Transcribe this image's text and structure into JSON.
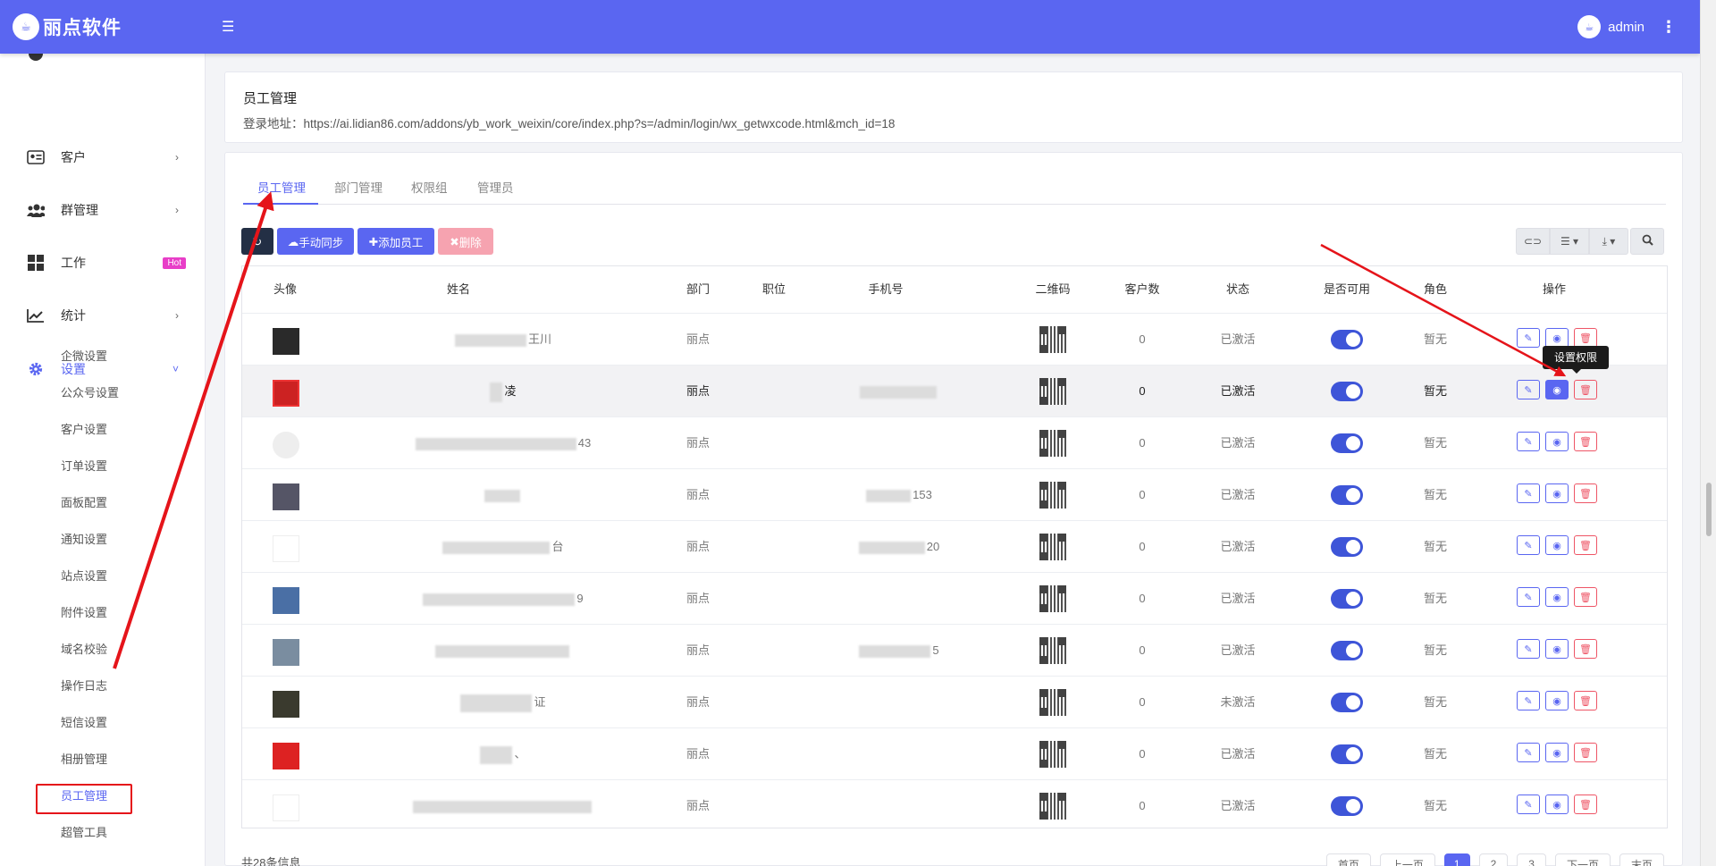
{
  "app": {
    "brand": "丽点软件",
    "user": "admin"
  },
  "sidebar": {
    "items": [
      {
        "label": "客户",
        "icon": "id-card-icon"
      },
      {
        "label": "群管理",
        "icon": "users-icon"
      },
      {
        "label": "工作",
        "icon": "grid-icon",
        "badge": "Hot"
      },
      {
        "label": "统计",
        "icon": "chart-line-icon"
      },
      {
        "label": "设置",
        "icon": "gear-icon"
      }
    ],
    "sub_items": [
      "企微设置",
      "公众号设置",
      "客户设置",
      "订单设置",
      "面板配置",
      "通知设置",
      "站点设置",
      "附件设置",
      "域名校验",
      "操作日志",
      "短信设置",
      "相册管理",
      "员工管理",
      "超管工具"
    ]
  },
  "header_card": {
    "title": "员工管理",
    "login_url": "登录地址：https://ai.lidian86.com/addons/yb_work_weixin/core/index.php?s=/admin/login/wx_getwxcode.html&mch_id=18"
  },
  "tabs": [
    "员工管理",
    "部门管理",
    "权限组",
    "管理员"
  ],
  "toolbar": {
    "sync": "手动同步",
    "add": "添加员工",
    "delete": "删除"
  },
  "table": {
    "columns": [
      "头像",
      "姓名",
      "部门",
      "职位",
      "手机号",
      "二维码",
      "客户数",
      "状态",
      "是否可用",
      "角色",
      "操作"
    ],
    "rows": [
      {
        "name": "王川",
        "dept": "丽点",
        "phone": "",
        "customers": "0",
        "status": "已激活",
        "role": "暂无"
      },
      {
        "name": "凌",
        "dept": "丽点",
        "phone": "",
        "customers": "0",
        "status": "已激活",
        "role": "暂无"
      },
      {
        "name": "43",
        "dept": "丽点",
        "phone": "",
        "customers": "0",
        "status": "已激活",
        "role": "暂无"
      },
      {
        "name": "",
        "dept": "丽点",
        "phone": "153",
        "customers": "0",
        "status": "已激活",
        "role": "暂无"
      },
      {
        "name": "台",
        "dept": "丽点",
        "phone": "20",
        "customers": "0",
        "status": "已激活",
        "role": "暂无"
      },
      {
        "name": "9",
        "dept": "丽点",
        "phone": "",
        "customers": "0",
        "status": "已激活",
        "role": "暂无"
      },
      {
        "name": "",
        "dept": "丽点",
        "phone": "5",
        "customers": "0",
        "status": "已激活",
        "role": "暂无"
      },
      {
        "name": "证",
        "dept": "丽点",
        "phone": "",
        "customers": "0",
        "status": "未激活",
        "role": "暂无"
      },
      {
        "name": "、",
        "dept": "丽点",
        "phone": "",
        "customers": "0",
        "status": "已激活",
        "role": "暂无"
      },
      {
        "name": "",
        "dept": "丽点",
        "phone": "",
        "customers": "0",
        "status": "已激活",
        "role": "暂无"
      }
    ]
  },
  "tooltip": "设置权限",
  "footer": {
    "total": "共28条信息",
    "pages": [
      "首页",
      "上一页",
      "1",
      "2",
      "3",
      "下一页",
      "末页"
    ]
  },
  "colors": {
    "primary": "#5a66f1",
    "danger": "#ee5566",
    "hot_badge": "#e83ec8",
    "annotation": "#e5141a"
  }
}
